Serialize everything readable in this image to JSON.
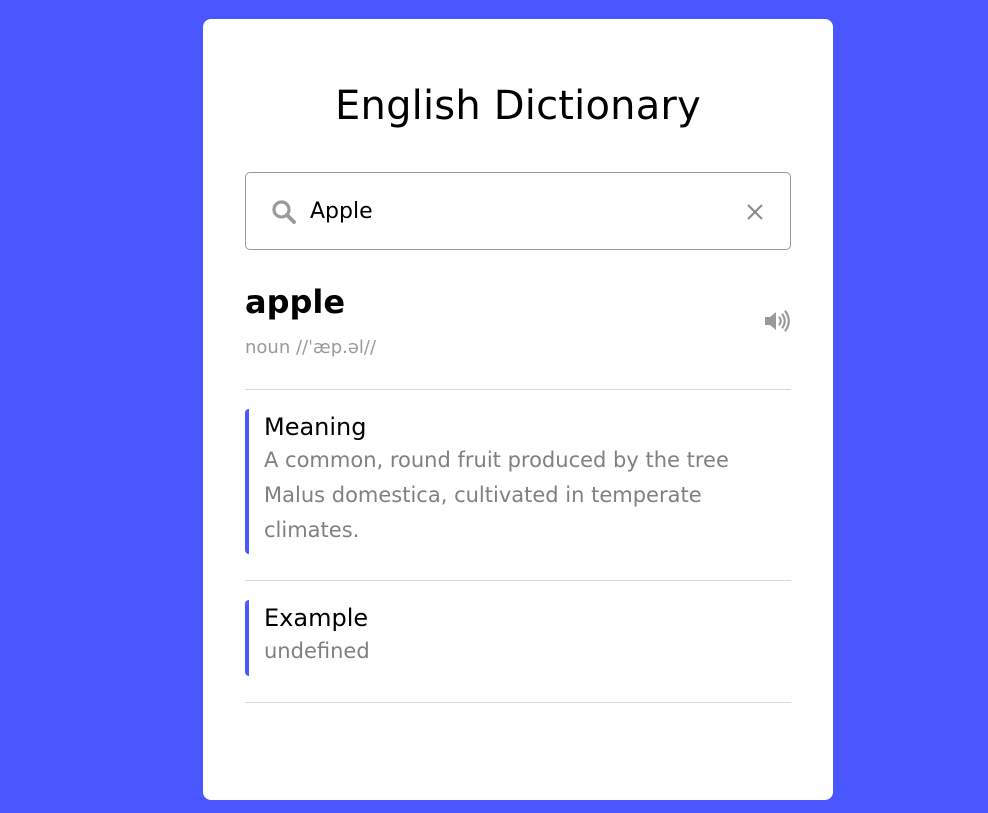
{
  "header": {
    "title": "English Dictionary"
  },
  "search": {
    "value": "Apple",
    "icon": "search-icon",
    "clear_icon": "close-icon"
  },
  "result": {
    "word": "apple",
    "phonetic": "noun //ˈæp.əl//",
    "audio_icon": "volume-icon",
    "meaning": {
      "label": "Meaning",
      "text": "A common, round fruit produced by the tree Malus domestica, cultivated in temperate climates."
    },
    "example": {
      "label": "Example",
      "text": "undefined"
    }
  },
  "colors": {
    "background": "#4a56ff",
    "card": "#ffffff",
    "accent": "#4a56ff",
    "muted_text": "#808080"
  }
}
